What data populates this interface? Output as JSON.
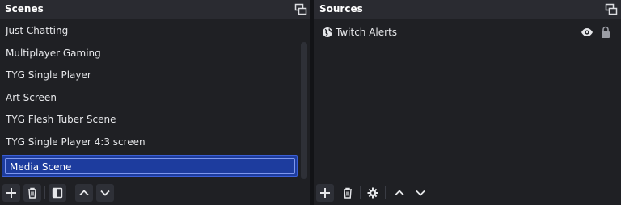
{
  "scenes": {
    "title": "Scenes",
    "items": [
      {
        "label": "Just Chatting"
      },
      {
        "label": "Multiplayer Gaming"
      },
      {
        "label": "TYG Single Player"
      },
      {
        "label": "Art Screen"
      },
      {
        "label": "TYG Flesh Tuber Scene"
      },
      {
        "label": "TYG Single Player 4:3 screen"
      }
    ],
    "selected": {
      "label": "Media Scene"
    },
    "toolbar": [
      "add-icon",
      "trash-icon",
      "filter-icon",
      "chevron-up-icon",
      "chevron-down-icon"
    ]
  },
  "sources": {
    "title": "Sources",
    "items": [
      {
        "label": "Twitch Alerts",
        "icon": "browser-globe-icon",
        "visible": true,
        "locked": true
      }
    ],
    "toolbar": [
      "add-icon",
      "trash-icon",
      "gear-icon",
      "chevron-up-icon",
      "chevron-down-icon"
    ]
  },
  "colors": {
    "background": "#1f2024",
    "header": "#2a2b31",
    "selection": "#1d3c9e",
    "selection_border": "#3b5fd6",
    "text": "#e6e7ea"
  }
}
